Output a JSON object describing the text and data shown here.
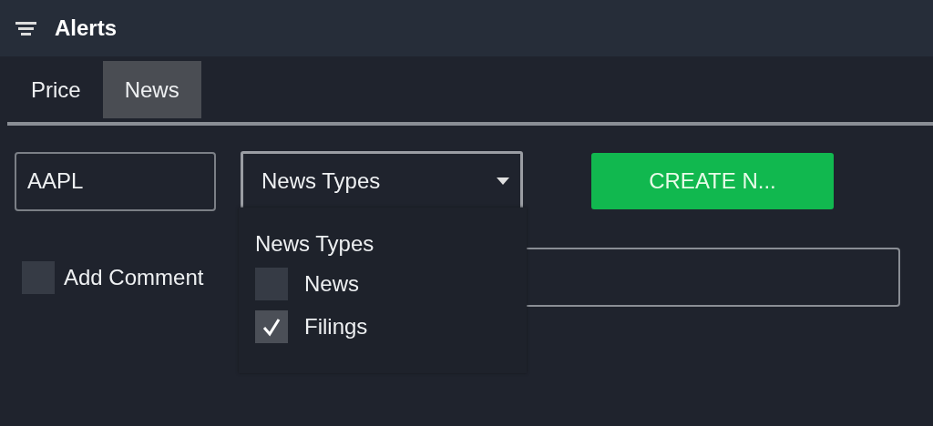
{
  "window": {
    "title": "Alerts"
  },
  "tabs": [
    {
      "label": "Price",
      "selected": false
    },
    {
      "label": "News",
      "selected": true
    }
  ],
  "symbol_field": {
    "value": "AAPL"
  },
  "news_types_dropdown": {
    "label": "News Types",
    "expanded": true
  },
  "create_button": {
    "label": "CREATE N..."
  },
  "add_comments": {
    "label": "Add Comment",
    "checked": false
  },
  "dropdown_menu": {
    "heading": "News Types",
    "options": [
      {
        "label": "News",
        "checked": false
      },
      {
        "label": "Filings",
        "checked": true
      }
    ]
  }
}
